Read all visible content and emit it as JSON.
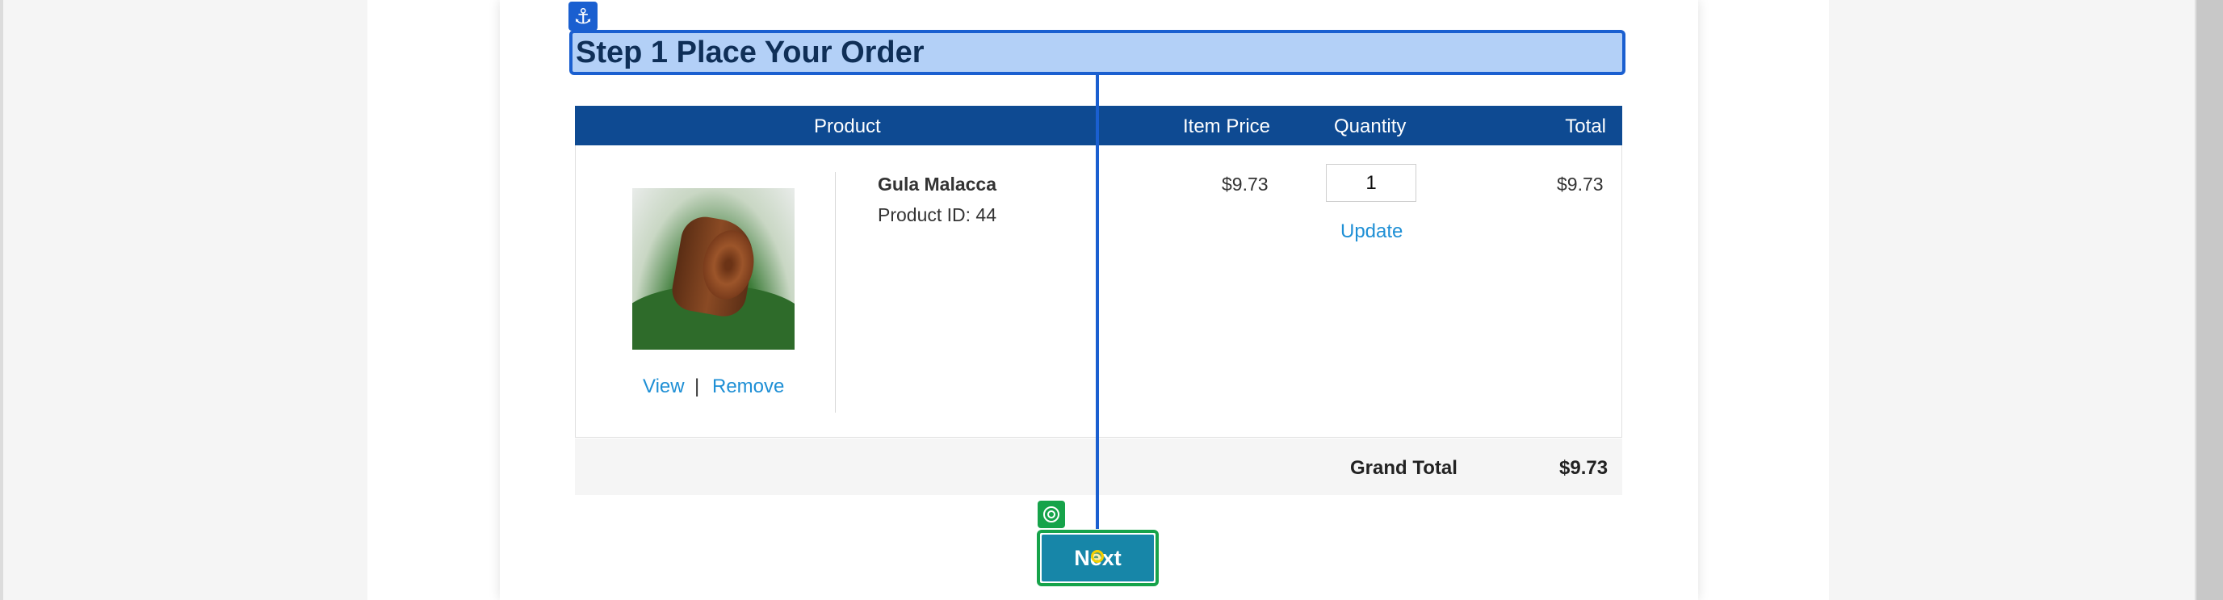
{
  "checkout": {
    "step_title": "Step 1 Place Your Order",
    "table": {
      "headers": {
        "product": "Product",
        "item_price": "Item Price",
        "quantity": "Quantity",
        "total": "Total"
      },
      "rows": [
        {
          "image_icon": "product-photo",
          "name": "Gula Malacca",
          "product_id": "Product ID: 44",
          "view_label": "View",
          "separator": "|",
          "remove_label": "Remove",
          "item_price": "$9.73",
          "quantity": "1",
          "update_label": "Update",
          "total": "$9.73"
        }
      ],
      "grand_total_label": "Grand Total",
      "grand_total_value": "$9.73"
    },
    "next_label": "Next"
  },
  "overlay": {
    "anchor_icon": "anchor-icon",
    "target_icon": "target-icon",
    "highlight_color": "#1a5fd0",
    "target_color": "#16a34a"
  },
  "colors": {
    "header_bg": "#0e4a92",
    "link": "#1e8fd5",
    "next_button": "#1786a8"
  }
}
